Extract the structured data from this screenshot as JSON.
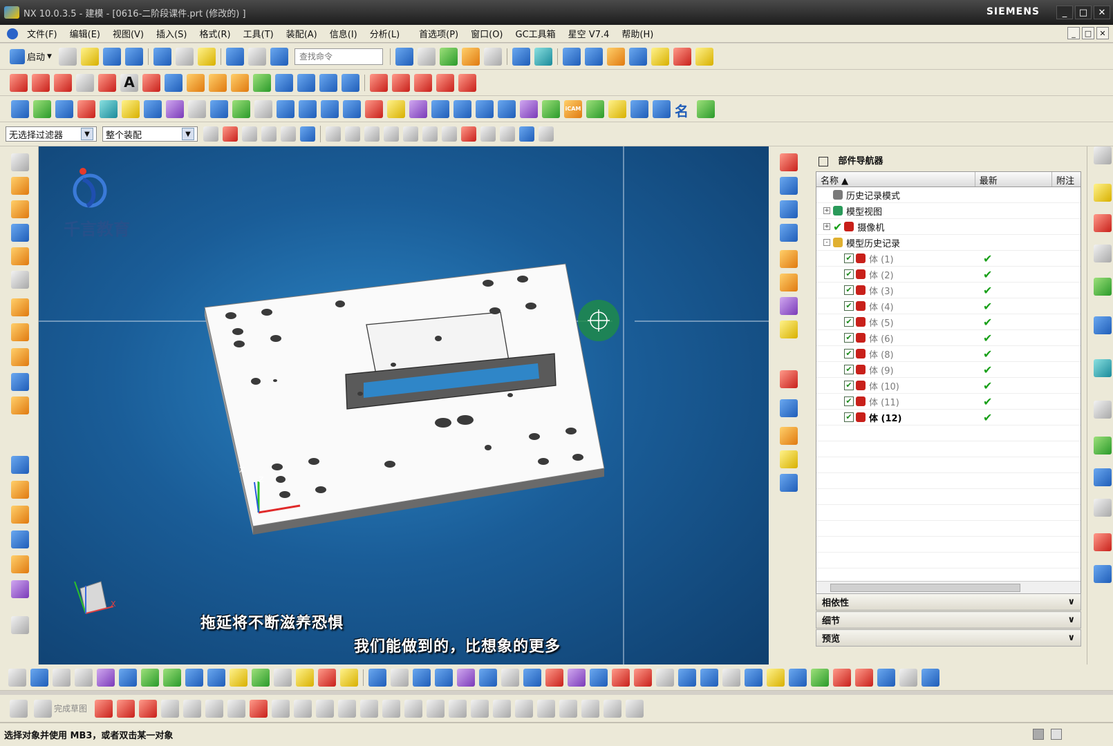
{
  "window": {
    "title": "NX 10.0.3.5 - 建模 - [0616-二阶段课件.prt  (修改的) ]",
    "brand": "SIEMENS",
    "controls": [
      "_",
      "□",
      "✕"
    ]
  },
  "menubar": {
    "items": [
      "文件(F)",
      "编辑(E)",
      "视图(V)",
      "插入(S)",
      "格式(R)",
      "工具(T)",
      "装配(A)",
      "信息(I)",
      "分析(L)",
      "首选项(P)",
      "窗口(O)",
      "GC工具箱",
      "星空 V7.4",
      "帮助(H)"
    ]
  },
  "toolbar1": {
    "start_label": "启动",
    "search_placeholder": "查找命令"
  },
  "selectionbar": {
    "filter": "无选择过滤器",
    "scope": "整个装配"
  },
  "watermark": {
    "brand": "千言教育"
  },
  "subtitles": {
    "line1": "拖延将不断滋养恐惧",
    "line2": "我们能做到的，比想象的更多"
  },
  "navigator": {
    "title": "部件导航器",
    "columns": [
      "名称",
      "最新",
      "附注"
    ],
    "rows": [
      {
        "label": "历史记录模式",
        "icon": "clock-icon",
        "expand": "",
        "latest": ""
      },
      {
        "label": "模型视图",
        "icon": "model-views-icon",
        "expand": "+",
        "latest": ""
      },
      {
        "label": "摄像机",
        "icon": "camera-icon",
        "expand": "+",
        "latest": ""
      },
      {
        "label": "模型历史记录",
        "icon": "folder-icon",
        "expand": "-",
        "latest": ""
      },
      {
        "label": "体 (1)",
        "icon": "body-icon",
        "expand": "",
        "latest": "✔"
      },
      {
        "label": "体 (2)",
        "icon": "body-icon",
        "expand": "",
        "latest": "✔"
      },
      {
        "label": "体 (3)",
        "icon": "body-icon",
        "expand": "",
        "latest": "✔"
      },
      {
        "label": "体 (4)",
        "icon": "body-icon",
        "expand": "",
        "latest": "✔"
      },
      {
        "label": "体 (5)",
        "icon": "body-icon",
        "expand": "",
        "latest": "✔"
      },
      {
        "label": "体 (6)",
        "icon": "body-icon",
        "expand": "",
        "latest": "✔"
      },
      {
        "label": "体 (8)",
        "icon": "body-icon",
        "expand": "",
        "latest": "✔"
      },
      {
        "label": "体 (9)",
        "icon": "body-icon",
        "expand": "",
        "latest": "✔"
      },
      {
        "label": "体 (10)",
        "icon": "body-icon",
        "expand": "",
        "latest": "✔"
      },
      {
        "label": "体 (11)",
        "icon": "body-icon",
        "expand": "",
        "latest": "✔"
      },
      {
        "label": "体 (12)",
        "icon": "body-icon",
        "expand": "",
        "latest": "✔"
      }
    ],
    "panels": [
      "相依性",
      "细节",
      "预览"
    ]
  },
  "bottom_toolbar": {
    "finish_sketch": "完成草图"
  },
  "statusbar": {
    "message": "选择对象并使用 MB3，或者双击某一对象"
  },
  "axis_labels": {
    "x": "X",
    "y": "Y",
    "z": "Z"
  }
}
